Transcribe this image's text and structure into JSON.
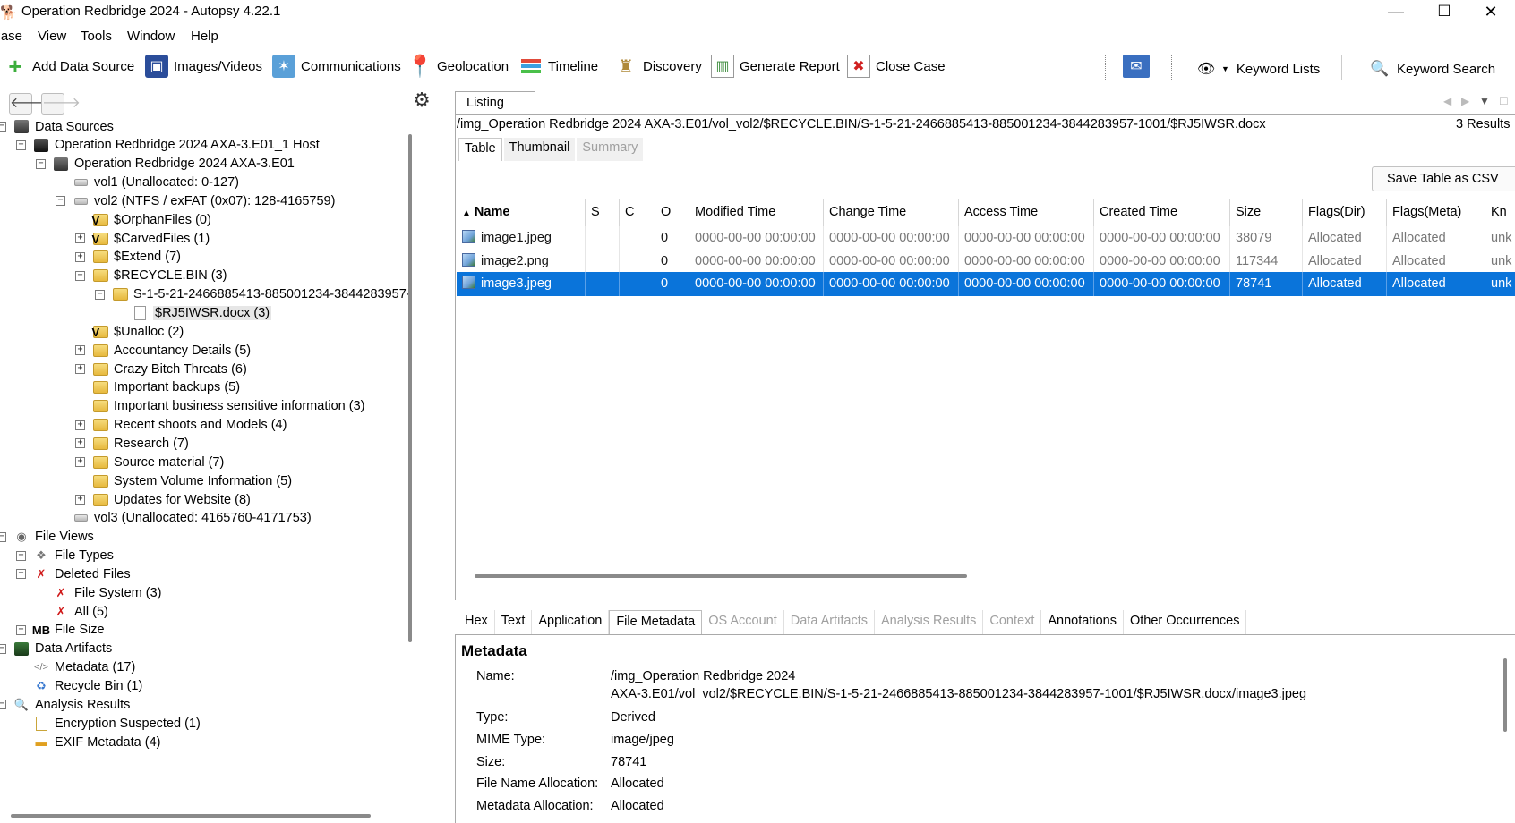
{
  "window": {
    "title": "Operation Redbridge 2024 - Autopsy 4.22.1",
    "minimize": "—",
    "maximize": "☐",
    "close": "✕"
  },
  "menu": [
    "Case",
    "View",
    "Tools",
    "Window",
    "Help"
  ],
  "toolbar": {
    "add_data_source": "Add Data Source",
    "images_videos": "Images/Videos",
    "communications": "Communications",
    "geolocation": "Geolocation",
    "timeline": "Timeline",
    "discovery": "Discovery",
    "generate_report": "Generate Report",
    "close_case": "Close Case",
    "keyword_lists": "Keyword Lists",
    "keyword_search": "Keyword Search"
  },
  "tree": [
    {
      "label": "Data Sources",
      "exp": "-",
      "icon": "hdd-icon"
    },
    {
      "label": "Operation Redbridge 2024 AXA-3.E01_1 Host",
      "exp": "-",
      "icon": "host-icon"
    },
    {
      "label": "Operation Redbridge 2024 AXA-3.E01",
      "exp": "-",
      "icon": "hdd-icon"
    },
    {
      "label": "vol1 (Unallocated: 0-127)",
      "exp": "",
      "icon": "volume-icon"
    },
    {
      "label": "vol2 (NTFS / exFAT (0x07): 128-4165759)",
      "exp": "-",
      "icon": "volume-icon"
    },
    {
      "label": "$OrphanFiles (0)",
      "exp": "",
      "icon": "virtual-folder-icon"
    },
    {
      "label": "$CarvedFiles (1)",
      "exp": "+",
      "icon": "virtual-folder-icon"
    },
    {
      "label": "$Extend (7)",
      "exp": "+",
      "icon": "folder-icon"
    },
    {
      "label": "$RECYCLE.BIN (3)",
      "exp": "-",
      "icon": "folder-icon"
    },
    {
      "label": "S-1-5-21-2466885413-885001234-3844283957-",
      "exp": "-",
      "icon": "folder-icon"
    },
    {
      "label": "$RJ5IWSR.docx (3)",
      "exp": "",
      "icon": "document-icon"
    },
    {
      "label": "$Unalloc (2)",
      "exp": "",
      "icon": "virtual-folder-icon"
    },
    {
      "label": "Accountancy Details (5)",
      "exp": "+",
      "icon": "folder-icon"
    },
    {
      "label": "Crazy Bitch Threats (6)",
      "exp": "+",
      "icon": "folder-icon"
    },
    {
      "label": "Important backups (5)",
      "exp": "",
      "icon": "folder-icon"
    },
    {
      "label": "Important business sensitive information (3)",
      "exp": "",
      "icon": "folder-icon"
    },
    {
      "label": "Recent shoots and Models (4)",
      "exp": "+",
      "icon": "folder-icon"
    },
    {
      "label": "Research (7)",
      "exp": "+",
      "icon": "folder-icon"
    },
    {
      "label": "Source material (7)",
      "exp": "+",
      "icon": "folder-icon"
    },
    {
      "label": "System Volume Information (5)",
      "exp": "",
      "icon": "folder-icon"
    },
    {
      "label": "Updates for Website (8)",
      "exp": "+",
      "icon": "folder-icon"
    },
    {
      "label": "vol3 (Unallocated: 4165760-4171753)",
      "exp": "",
      "icon": "volume-icon"
    },
    {
      "label": "File Views",
      "exp": "-",
      "icon": "eye-icon"
    },
    {
      "label": "File Types",
      "exp": "+",
      "icon": "file-types-icon"
    },
    {
      "label": "Deleted Files",
      "exp": "-",
      "icon": "deleted-icon"
    },
    {
      "label": "File System (3)",
      "exp": "",
      "icon": "deleted-icon"
    },
    {
      "label": "All (5)",
      "exp": "",
      "icon": "deleted-icon"
    },
    {
      "label": "File Size",
      "exp": "+",
      "icon": "mb-icon"
    },
    {
      "label": "Data Artifacts",
      "exp": "-",
      "icon": "artifacts-icon"
    },
    {
      "label": "Metadata (17)",
      "exp": "",
      "icon": "code-icon"
    },
    {
      "label": "Recycle Bin (1)",
      "exp": "",
      "icon": "recycle-icon"
    },
    {
      "label": "Analysis Results",
      "exp": "-",
      "icon": "magnifier-icon"
    },
    {
      "label": "Encryption Suspected (1)",
      "exp": "",
      "icon": "encryption-icon"
    },
    {
      "label": "EXIF Metadata (4)",
      "exp": "",
      "icon": "camera-icon"
    }
  ],
  "listing": {
    "tab": "Listing",
    "path": "/img_Operation Redbridge 2024 AXA-3.E01/vol_vol2/$RECYCLE.BIN/S-1-5-21-2466885413-885001234-3844283957-1001/$RJ5IWSR.docx",
    "results": "3   Results",
    "subtabs": [
      "Table",
      "Thumbnail",
      "Summary"
    ],
    "save_csv": "Save Table as CSV",
    "sort_arrow": "▲",
    "columns": [
      "Name",
      "S",
      "C",
      "O",
      "Modified Time",
      "Change Time",
      "Access Time",
      "Created Time",
      "Size",
      "Flags(Dir)",
      "Flags(Meta)",
      "Kn"
    ],
    "rows": [
      {
        "name": "image1.jpeg",
        "s": "",
        "c": "",
        "o": "0",
        "modified": "0000-00-00 00:00:00",
        "change": "0000-00-00 00:00:00",
        "access": "0000-00-00 00:00:00",
        "created": "0000-00-00 00:00:00",
        "size": "38079",
        "flags_dir": "Allocated",
        "flags_meta": "Allocated",
        "known": "unk"
      },
      {
        "name": "image2.png",
        "s": "",
        "c": "",
        "o": "0",
        "modified": "0000-00-00 00:00:00",
        "change": "0000-00-00 00:00:00",
        "access": "0000-00-00 00:00:00",
        "created": "0000-00-00 00:00:00",
        "size": "117344",
        "flags_dir": "Allocated",
        "flags_meta": "Allocated",
        "known": "unk"
      },
      {
        "name": "image3.jpeg",
        "s": "",
        "c": "",
        "o": "0",
        "modified": "0000-00-00 00:00:00",
        "change": "0000-00-00 00:00:00",
        "access": "0000-00-00 00:00:00",
        "created": "0000-00-00 00:00:00",
        "size": "78741",
        "flags_dir": "Allocated",
        "flags_meta": "Allocated",
        "known": "unk"
      }
    ]
  },
  "content_tabs": [
    {
      "label": "Hex",
      "state": "normal"
    },
    {
      "label": "Text",
      "state": "normal"
    },
    {
      "label": "Application",
      "state": "normal"
    },
    {
      "label": "File Metadata",
      "state": "active"
    },
    {
      "label": "OS Account",
      "state": "disabled"
    },
    {
      "label": "Data Artifacts",
      "state": "disabled"
    },
    {
      "label": "Analysis Results",
      "state": "disabled"
    },
    {
      "label": "Context",
      "state": "disabled"
    },
    {
      "label": "Annotations",
      "state": "normal"
    },
    {
      "label": "Other Occurrences",
      "state": "normal"
    }
  ],
  "metadata": {
    "title": "Metadata",
    "name_label": "Name:",
    "name_line1": "/img_Operation Redbridge 2024",
    "name_line2": "AXA-3.E01/vol_vol2/$RECYCLE.BIN/S-1-5-21-2466885413-885001234-3844283957-1001/$RJ5IWSR.docx/image3.jpeg",
    "type_label": "Type:",
    "type_value": "Derived",
    "mime_label": "MIME Type:",
    "mime_value": "image/jpeg",
    "size_label": "Size:",
    "size_value": "78741",
    "fna_label": "File Name Allocation:",
    "fna_value": "Allocated",
    "ma_label": "Metadata Allocation:",
    "ma_value": "Allocated"
  },
  "colors": {
    "selection": "#0a74da",
    "disabled_text": "#a0a0a0"
  }
}
